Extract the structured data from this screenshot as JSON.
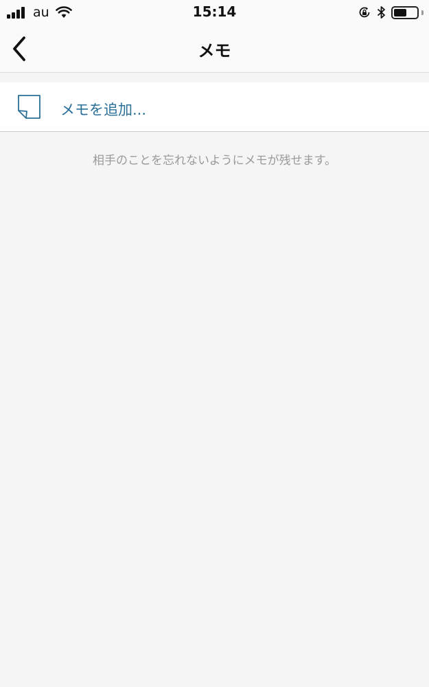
{
  "status_bar": {
    "carrier": "au",
    "time": "15:14",
    "battery_level": 0.55
  },
  "nav": {
    "title": "メモ",
    "back_icon": "chevron-left-icon"
  },
  "memo": {
    "add_label": "メモを追加...",
    "add_icon": "note-icon",
    "hint": "相手のことを忘れないようにメモが残せます。"
  },
  "colors": {
    "accent": "#2a6f98",
    "background": "#f5f5f5",
    "hint": "#9a9a9a"
  }
}
